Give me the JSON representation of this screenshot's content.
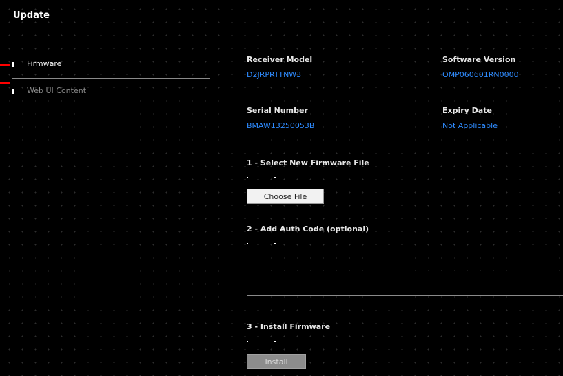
{
  "page": {
    "title": "Update"
  },
  "sidebar": {
    "items": [
      {
        "label": "Firmware",
        "active": true,
        "color": "#ffffff"
      },
      {
        "label": "Web UI Content",
        "active": false,
        "color": "#8c8c8c"
      }
    ],
    "marker_color": "#ff0000"
  },
  "info": {
    "receiver_model": {
      "label": "Receiver Model",
      "value": "D2JRPRTTNW3"
    },
    "software_version": {
      "label": "Software Version",
      "value": "OMP060601RN0000"
    },
    "serial_number": {
      "label": "Serial Number",
      "value": "BMAW13250053B"
    },
    "expiry_date": {
      "label": "Expiry Date",
      "value": "Not Applicable"
    },
    "value_color": "#2e8bff"
  },
  "steps": {
    "select_file": {
      "title": "1 - Select New Firmware File",
      "button_label": "Choose File"
    },
    "auth_code": {
      "title": "2 - Add Auth Code (optional)",
      "input_value": ""
    },
    "install": {
      "title": "3 - Install Firmware",
      "button_label": "Install",
      "enabled": false
    }
  }
}
